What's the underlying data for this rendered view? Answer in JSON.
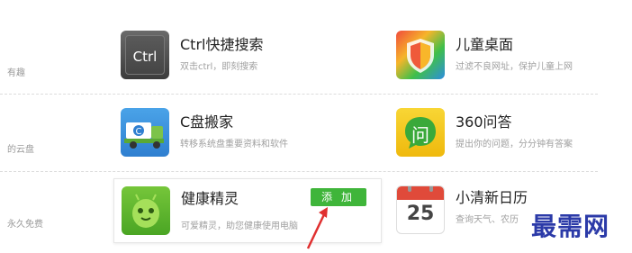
{
  "left_fragments": [
    "有趣",
    "的云盘",
    "永久免费"
  ],
  "apps": [
    {
      "name": "Ctrl快捷搜索",
      "desc": "双击ctrl，即刻搜索",
      "icon_name": "ctrl-key-icon",
      "icon_text": "Ctrl"
    },
    {
      "name": "儿童桌面",
      "desc": "过滤不良网址，保护儿童上网",
      "icon_name": "shield-icon"
    },
    {
      "name": "C盘搬家",
      "desc": "转移系统盘重要资料和软件",
      "icon_name": "moving-truck-icon"
    },
    {
      "name": "360问答",
      "desc": "提出你的问题，分分钟有答案",
      "icon_name": "qa-bubble-icon",
      "icon_text": "问"
    },
    {
      "name": "健康精灵",
      "desc": "可爱精灵，助您健康使用电脑",
      "icon_name": "android-sprite-icon",
      "add_label": "添加"
    },
    {
      "name": "小清新日历",
      "desc": "查询天气、农历",
      "icon_name": "calendar-icon",
      "icon_text": "25"
    }
  ],
  "watermark": "最需网",
  "colors": {
    "add_button": "#3fb53a",
    "arrow": "#e03030",
    "watermark": "#2b3aa8"
  }
}
